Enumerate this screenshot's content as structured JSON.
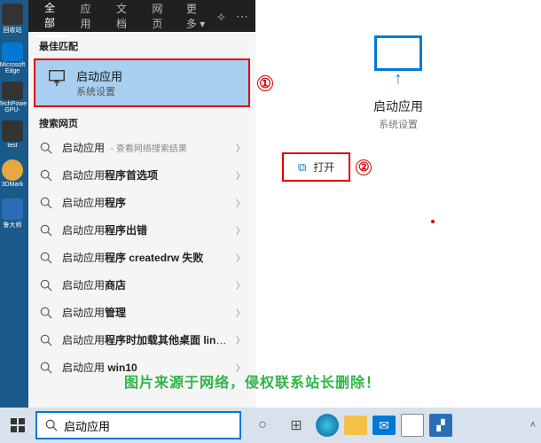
{
  "desktop": {
    "icons": [
      "回收站",
      "Microsoft Edge",
      "TechPowe GPU-",
      "test",
      "3DMark",
      "鲁大师"
    ]
  },
  "tabs": {
    "all": "全部",
    "apps": "应用",
    "docs": "文档",
    "web": "网页",
    "more": "更多"
  },
  "sections": {
    "best_match": "最佳匹配",
    "web_search": "搜索网页"
  },
  "best_match": {
    "title": "启动应用",
    "subtitle": "系统设置"
  },
  "results": [
    {
      "prefix": "启动应用",
      "suffix": "",
      "hint": " - 查看网络搜索结果"
    },
    {
      "prefix": "启动应用",
      "suffix": "程序首选项",
      "hint": ""
    },
    {
      "prefix": "启动应用",
      "suffix": "程序",
      "hint": ""
    },
    {
      "prefix": "启动应用",
      "suffix": "程序出错",
      "hint": ""
    },
    {
      "prefix": "启动应用",
      "suffix": "程序 createdrw 失败",
      "hint": ""
    },
    {
      "prefix": "启动应用",
      "suffix": "商店",
      "hint": ""
    },
    {
      "prefix": "启动应用",
      "suffix": "管理",
      "hint": ""
    },
    {
      "prefix": "启动应用",
      "suffix": "程序时加载其他桌面 linux",
      "hint": ""
    },
    {
      "prefix": "启动应用",
      "suffix": " win10",
      "hint": ""
    }
  ],
  "preview": {
    "title": "启动应用",
    "subtitle": "系统设置",
    "open": "打开"
  },
  "annotations": {
    "one": "①",
    "two": "②"
  },
  "watermark": "图片来源于网络，侵权联系站长删除！",
  "search": {
    "value": "启动应用"
  }
}
